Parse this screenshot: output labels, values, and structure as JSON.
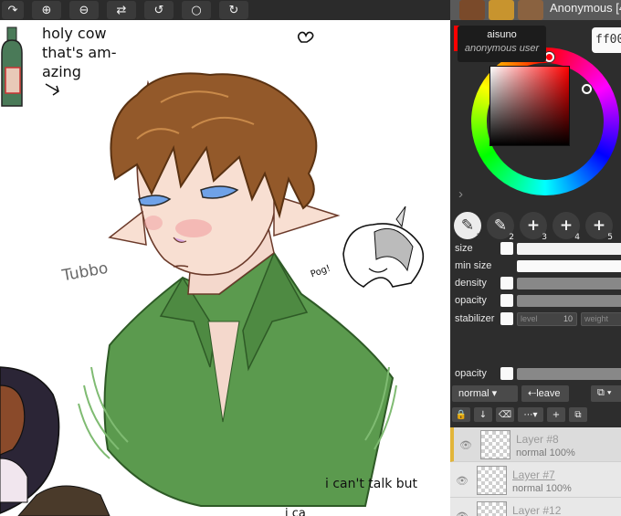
{
  "toolbar": {
    "buttons": [
      {
        "name": "redo-arrow",
        "glyph": "↷"
      },
      {
        "name": "zoom-in",
        "glyph": "⊕"
      },
      {
        "name": "zoom-out",
        "glyph": "⊖"
      },
      {
        "name": "flip",
        "glyph": "⇄"
      },
      {
        "name": "rotate-left",
        "glyph": "↺"
      },
      {
        "name": "reset-rotation",
        "glyph": "○"
      },
      {
        "name": "rotate-right",
        "glyph": "↻"
      }
    ]
  },
  "user": {
    "name": "Anonymous",
    "count_partial": "[4",
    "tooltip_name": "aisuno",
    "tooltip_subtitle": "anonymous user"
  },
  "color": {
    "hex_value": "ff00",
    "current": "#ff0000"
  },
  "brushes": [
    {
      "icon": "pen-icon",
      "glyph": "✎",
      "num": "1",
      "active": true
    },
    {
      "icon": "brush-icon",
      "glyph": "✎",
      "num": "2",
      "active": false
    },
    {
      "icon": "plus-icon",
      "glyph": "+",
      "num": "3",
      "active": false
    },
    {
      "icon": "plus-icon",
      "glyph": "+",
      "num": "4",
      "active": false
    },
    {
      "icon": "plus-icon",
      "glyph": "+",
      "num": "5",
      "active": false
    }
  ],
  "tool_settings": {
    "size": "size",
    "min_size": "min size",
    "density": "density",
    "opacity": "opacity",
    "stabilizer": "stabilizer",
    "level_label": "level",
    "level_value": "10",
    "weight_label": "weight"
  },
  "layer_panel": {
    "opacity_label": "opacity",
    "blend_mode": "normal",
    "leave_label": "leave",
    "layers": [
      {
        "name": "Layer #8",
        "mode": "normal 100%"
      },
      {
        "name": "Layer #7",
        "mode": "normal 100%"
      },
      {
        "name": "Layer #12",
        "mode": ""
      }
    ]
  },
  "canvas_text": {
    "note_line1": "holy cow",
    "note_line2": "that's am-",
    "note_line3": "azing",
    "signature": "Tubbo",
    "poggers": "Pog!",
    "note_bottom": "i can't talk but",
    "note_bottom2": "i ca"
  }
}
